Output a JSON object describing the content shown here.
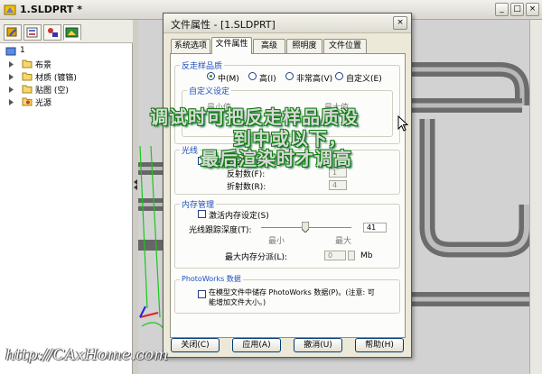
{
  "window": {
    "title": "1.SLDPRT *",
    "controls": [
      "_",
      "□",
      "×"
    ]
  },
  "tree": {
    "root": "1",
    "items": [
      {
        "label": "布景",
        "icon": "folder-icon"
      },
      {
        "label": "材质 (镀铬)",
        "icon": "folder-icon"
      },
      {
        "label": "贴图 (空)",
        "icon": "folder-icon"
      },
      {
        "label": "光源",
        "icon": "light-folder-icon"
      }
    ]
  },
  "dialog": {
    "title": "文件属性 - [1.SLDPRT]",
    "close": "×",
    "tabs": [
      "系统选项",
      "文件属性",
      "高级",
      "照明度",
      "文件位置"
    ],
    "active_tab": "文件属性",
    "antialias": {
      "group_label": "反走样品质",
      "options": [
        "中(M)",
        "高(I)",
        "非常高(V)",
        "自定义(E)"
      ],
      "selected": "中(M)"
    },
    "custom": {
      "group_label": "自定义设定",
      "left_hint": "最小值",
      "right_hint": "最大值"
    },
    "raytrace": {
      "group_label": "光线",
      "custom_label": "自定义设定(I)",
      "reflections_label": "反射数(F):",
      "reflections_value": "1",
      "refractions_label": "折射数(R):",
      "refractions_value": "4"
    },
    "memory": {
      "group_label": "内存管理",
      "activate_label": "激活内存设定(S)",
      "depth_label": "光线跟踪深度(T):",
      "depth_value": "41",
      "min_label": "最小",
      "max_label": "最大",
      "max_mem_label": "最大内存分派(L):",
      "max_mem_value": "0",
      "unit": "Mb"
    },
    "photoworks": {
      "group_label": "PhotoWorks 数据",
      "save_label": "在模型文件中储存 PhotoWorks 数据(P)。(注意: 可",
      "save_label_2": "能增加文件大小。)"
    },
    "buttons": [
      "关闭(C)",
      "应用(A)",
      "撤消(U)",
      "帮助(H)"
    ]
  },
  "annotation": {
    "line1": "调试时可把反走样品质设",
    "line2": "到中或以下，",
    "line3": "最后渲染时才调高"
  },
  "watermark": "http://CAxHome.com",
  "colors": {
    "overlay_text": "#d8d8d8",
    "overlay_outline": "#0a7a0a",
    "group_label": "#1e4fbf",
    "pipe": "#7a7a7a"
  }
}
